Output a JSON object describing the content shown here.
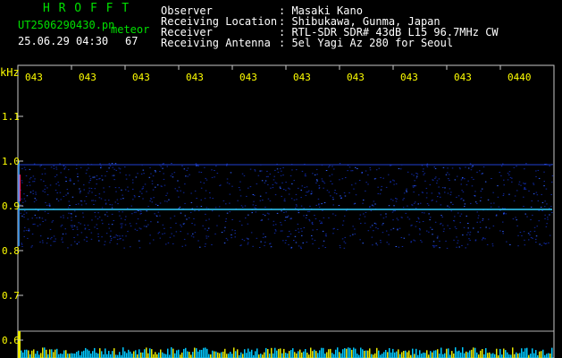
{
  "header": {
    "app_title": "H R O F F T",
    "filename": "UT2506290430.pn",
    "meteor_label": "meteor",
    "datetime": "25.06.29 04:30",
    "meteor_count": "67",
    "info": [
      {
        "label": "Observer",
        "value": ": Masaki Kano"
      },
      {
        "label": "Receiving Location",
        "value": ": Shibukawa, Gunma, Japan"
      },
      {
        "label": "Receiver",
        "value": ": RTL-SDR SDR# 43dB L15 96.7MHz CW"
      },
      {
        "label": "Receiving Antenna",
        "value": ": 5el Yagi Az 280 for Seoul"
      }
    ]
  },
  "axis": {
    "unit": "kHz",
    "y_ticks": [
      "1.1",
      "1.0",
      "0.9",
      "0.8",
      "0.7",
      "0.6"
    ],
    "x_ticks": [
      "043",
      "043",
      "043",
      "043",
      "043",
      "043",
      "043",
      "043",
      "043",
      "0440"
    ]
  },
  "colors": {
    "background": "#000000",
    "header_text": "#ffffff",
    "title": "#00e000",
    "axis_text": "#ffff00",
    "frame": "#c8c8c8",
    "signal_line": "#30d0ff",
    "noise_band": "#1030c0",
    "strip_yellow": "#e8e800",
    "strip_cyan": "#00c8ff"
  }
}
